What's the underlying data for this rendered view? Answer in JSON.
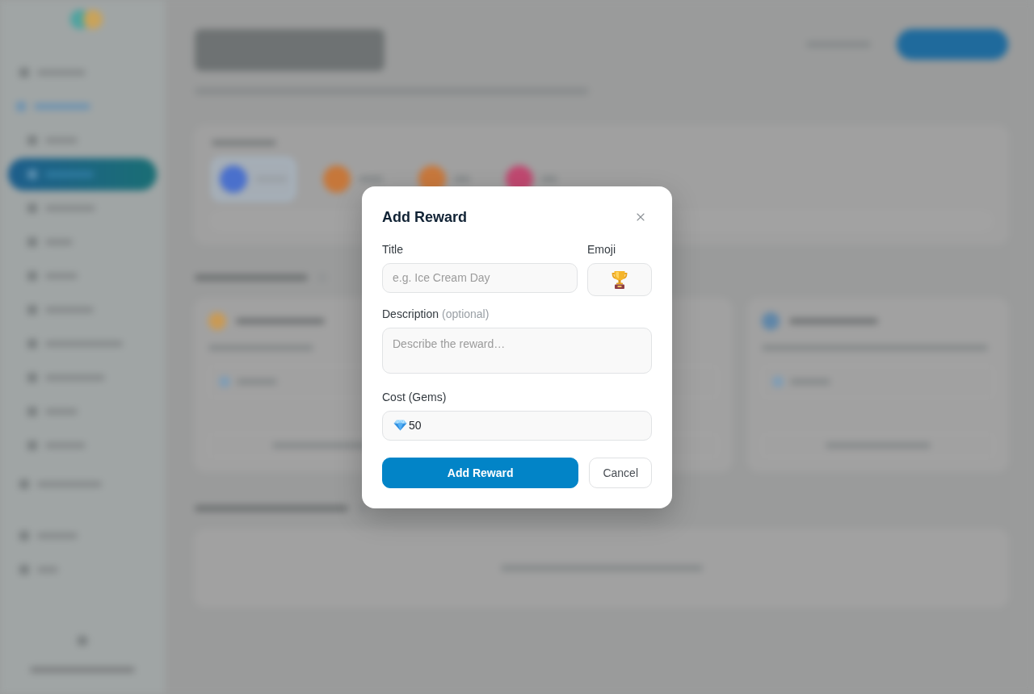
{
  "dialog": {
    "title": "Add Reward",
    "fields": [
      {
        "kind": "text",
        "label": "Title",
        "placeholder": "e.g. Ice Cream Day"
      },
      {
        "kind": "emoji",
        "label": "Emoji"
      },
      {
        "kind": "textarea",
        "label": "Description",
        "hint": "(optional)",
        "placeholder": "Describe the reward…"
      },
      {
        "kind": "gems",
        "label": "Cost (Gems)",
        "value": "50"
      }
    ],
    "buttons": [
      {
        "kind": "primary",
        "label": "Add Reward"
      },
      {
        "kind": "secondary",
        "label": "Cancel"
      }
    ]
  }
}
